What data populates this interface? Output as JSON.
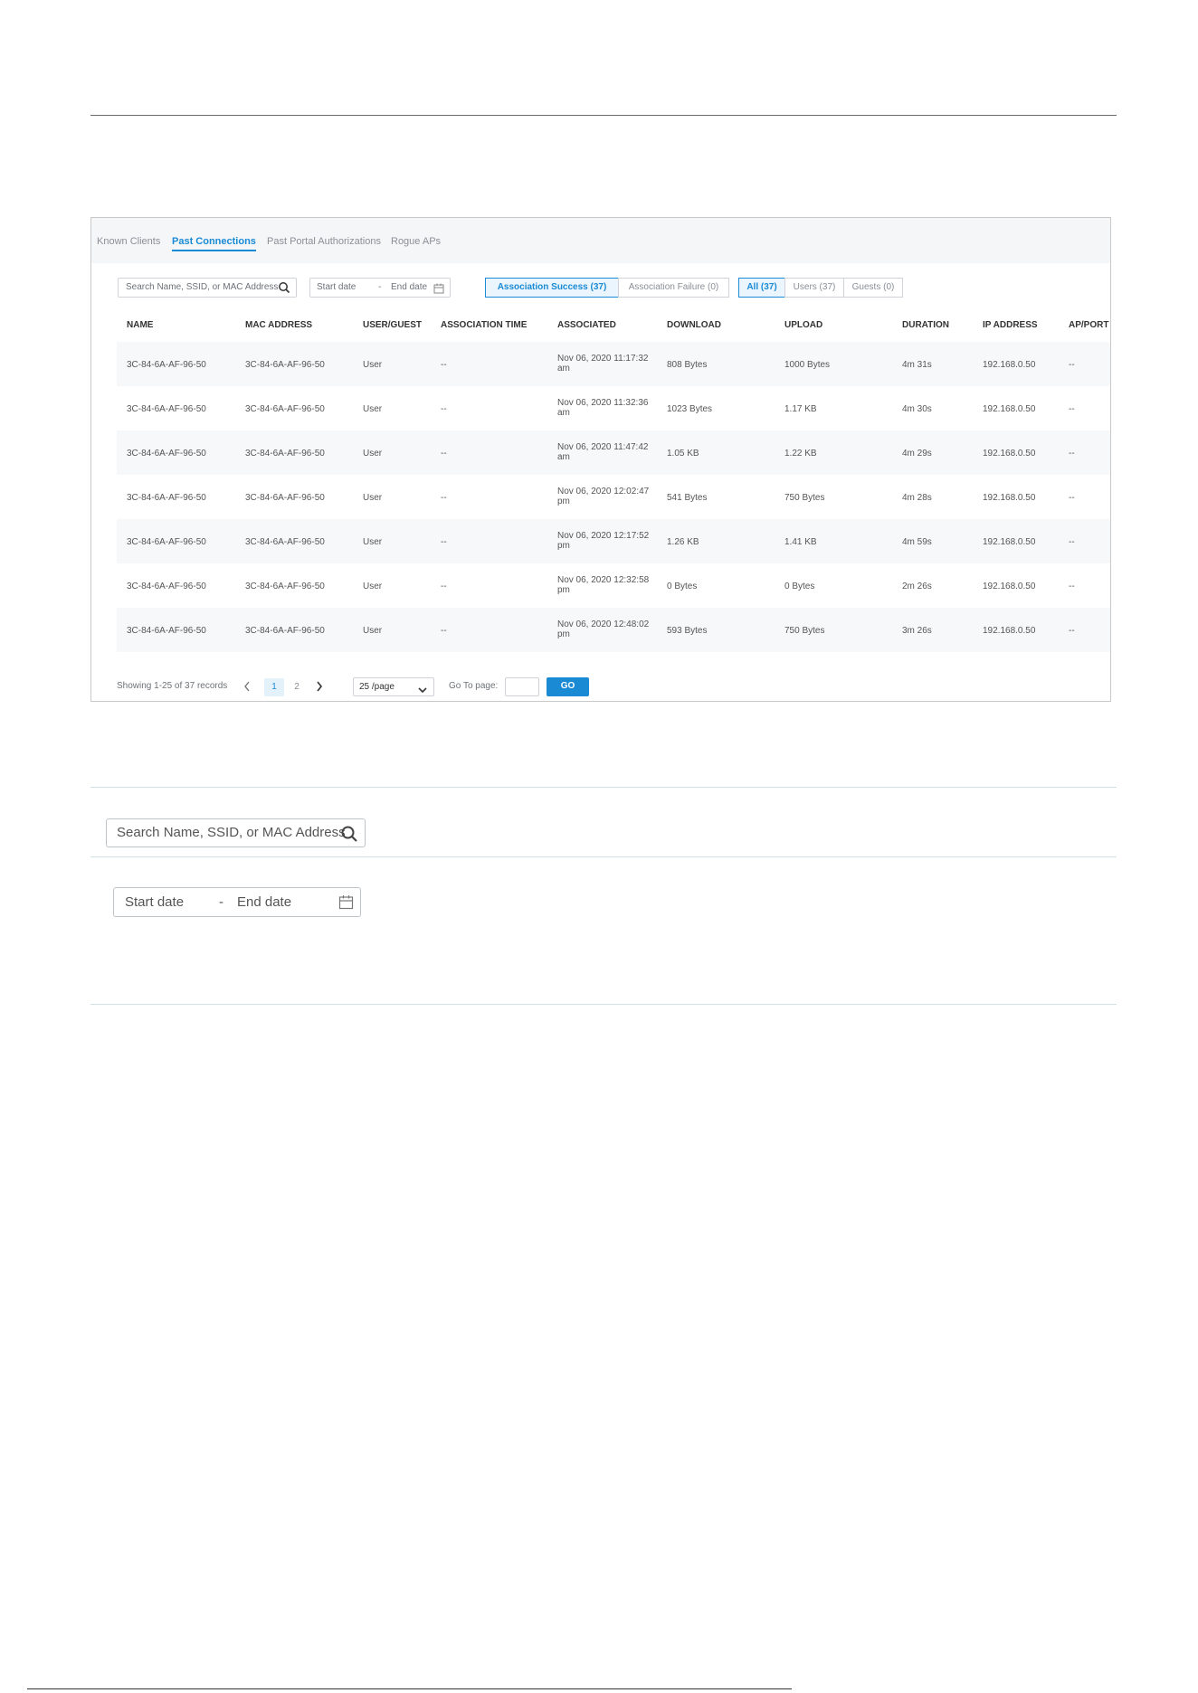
{
  "tabs": [
    "Known Clients",
    "Past Connections",
    "Past Portal Authorizations",
    "Rogue APs"
  ],
  "active_tab": "Past Connections",
  "search": {
    "placeholder": "Search Name, SSID, or MAC Address"
  },
  "date_range": {
    "start": "Start date",
    "separator": "-",
    "end": "End date"
  },
  "association_filter": [
    {
      "label": "Association Success (37)",
      "active": true
    },
    {
      "label": "Association Failure (0)",
      "active": false
    }
  ],
  "user_filter": [
    {
      "label": "All (37)",
      "active": true
    },
    {
      "label": "Users (37)",
      "active": false
    },
    {
      "label": "Guests (0)",
      "active": false
    }
  ],
  "table": {
    "columns": [
      "NAME",
      "MAC ADDRESS",
      "USER/GUEST",
      "ASSOCIATION TIME",
      "ASSOCIATED",
      "DOWNLOAD",
      "UPLOAD",
      "DURATION",
      "IP ADDRESS",
      "AP/PORT"
    ],
    "rows": [
      [
        "3C-84-6A-AF-96-50",
        "3C-84-6A-AF-96-50",
        "User",
        "--",
        "Nov 06, 2020 11:17:32 am",
        "808 Bytes",
        "1000 Bytes",
        "4m 31s",
        "192.168.0.50",
        "--"
      ],
      [
        "3C-84-6A-AF-96-50",
        "3C-84-6A-AF-96-50",
        "User",
        "--",
        "Nov 06, 2020 11:32:36 am",
        "1023 Bytes",
        "1.17 KB",
        "4m 30s",
        "192.168.0.50",
        "--"
      ],
      [
        "3C-84-6A-AF-96-50",
        "3C-84-6A-AF-96-50",
        "User",
        "--",
        "Nov 06, 2020 11:47:42 am",
        "1.05 KB",
        "1.22 KB",
        "4m 29s",
        "192.168.0.50",
        "--"
      ],
      [
        "3C-84-6A-AF-96-50",
        "3C-84-6A-AF-96-50",
        "User",
        "--",
        "Nov 06, 2020 12:02:47 pm",
        "541 Bytes",
        "750 Bytes",
        "4m 28s",
        "192.168.0.50",
        "--"
      ],
      [
        "3C-84-6A-AF-96-50",
        "3C-84-6A-AF-96-50",
        "User",
        "--",
        "Nov 06, 2020 12:17:52 pm",
        "1.26 KB",
        "1.41 KB",
        "4m 59s",
        "192.168.0.50",
        "--"
      ],
      [
        "3C-84-6A-AF-96-50",
        "3C-84-6A-AF-96-50",
        "User",
        "--",
        "Nov 06, 2020 12:32:58 pm",
        "0 Bytes",
        "0 Bytes",
        "2m 26s",
        "192.168.0.50",
        "--"
      ],
      [
        "3C-84-6A-AF-96-50",
        "3C-84-6A-AF-96-50",
        "User",
        "--",
        "Nov 06, 2020 12:48:02 pm",
        "593 Bytes",
        "750 Bytes",
        "3m 26s",
        "192.168.0.50",
        "--"
      ]
    ]
  },
  "pagination": {
    "summary": "Showing 1-25 of 37 records",
    "pages": [
      "1",
      "2"
    ],
    "current_page": "1",
    "page_size": "25 /page",
    "goto_label": "Go To page:",
    "go_label": "GO"
  },
  "zoom_search": {
    "placeholder": "Search Name, SSID, or MAC Address"
  },
  "zoom_date": {
    "start": "Start date",
    "separator": "-",
    "end": "End date"
  },
  "colors": {
    "accent": "#1a8ad4",
    "row_alt": "#f7f8fa",
    "tabbar": "#f4f6f8"
  },
  "icons": {
    "search": "search-icon",
    "calendar": "calendar-icon",
    "prev": "chevron-left-icon",
    "next": "chevron-right-icon",
    "dropdown": "chevron-down-icon"
  }
}
